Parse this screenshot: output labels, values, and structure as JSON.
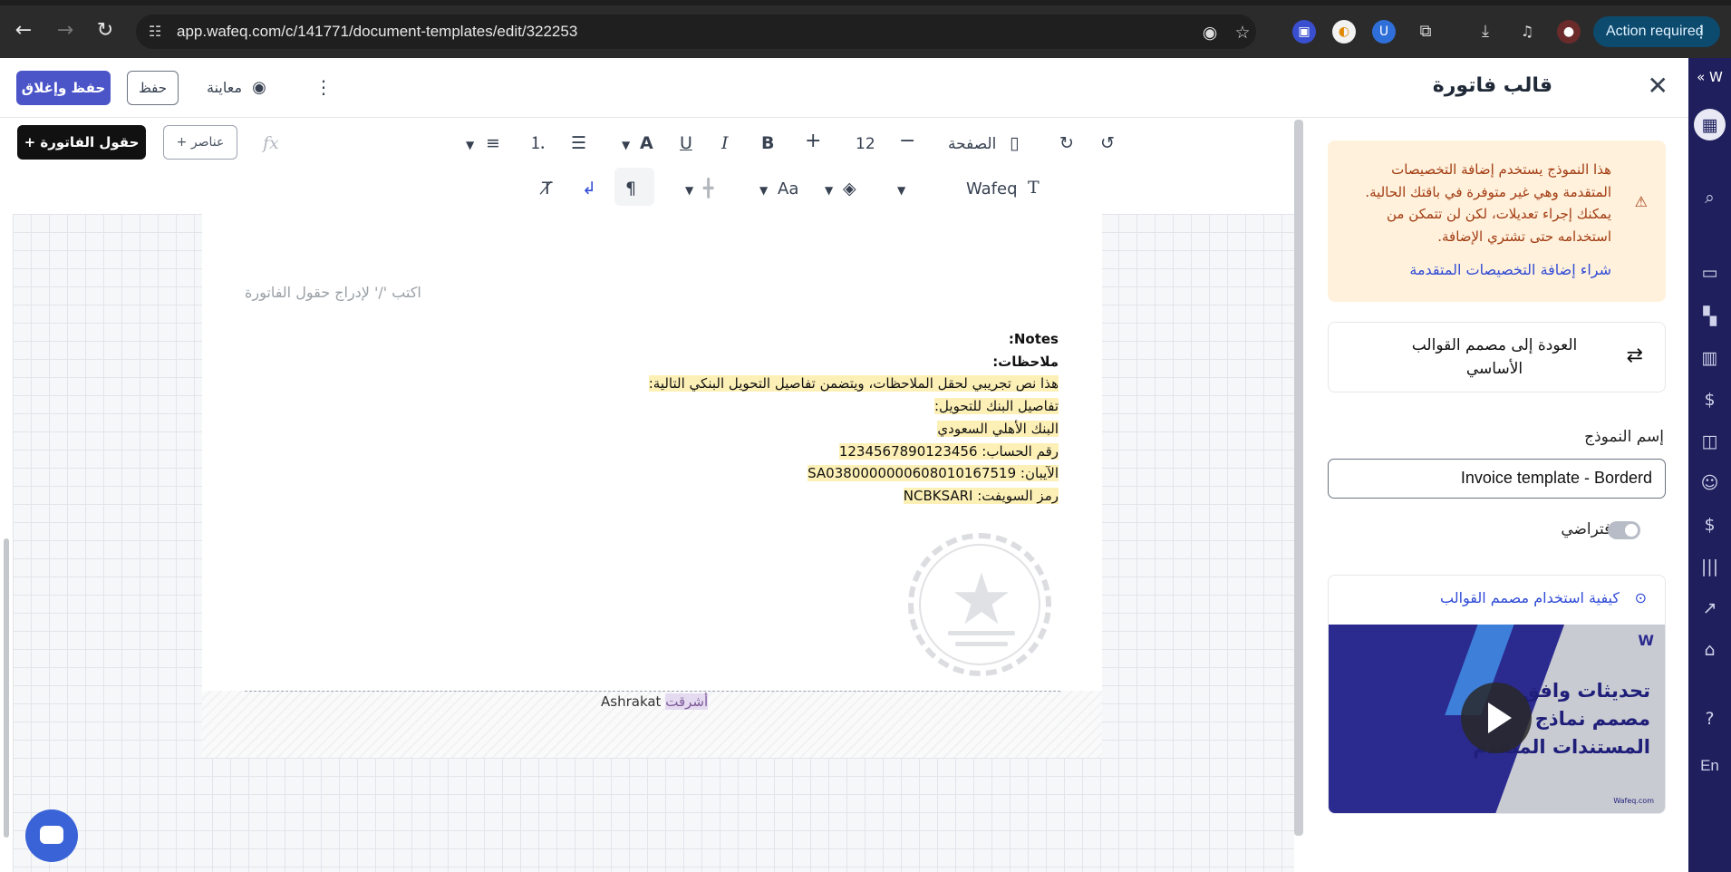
{
  "browser": {
    "url": "app.wafeq.com/c/141771/document-templates/edit/322253",
    "action_required": "Action required",
    "icons": [
      "back-arrow-icon",
      "forward-arrow-icon",
      "reload-icon",
      "site-settings-icon",
      "eye-icon",
      "star-icon",
      "extension-icon",
      "download-icon",
      "media-icon",
      "profile-icon",
      "kebab-icon"
    ]
  },
  "header": {
    "title": "قالب فاتورة",
    "save_close": "حفظ وإغلاق",
    "save": "حفظ",
    "preview": "معاينة"
  },
  "toolbar": {
    "invoice_fields": "+  حقول الفاتورة",
    "elements": "+ عناصر",
    "fx": "fx",
    "page": "الصفحة",
    "font_size": "12",
    "font_name": "Wafeq",
    "case": "Aa"
  },
  "document": {
    "placeholder": "اكتب '/' لإدراج حقول الفاتورة",
    "notes_en": "Notes:",
    "notes_ar": "ملاحظات:",
    "line1": "هذا نص تجريبي لحقل الملاحظات، ويتضمن تفاصيل التحويل البنكي التالية:",
    "line2": "تفاصيل البنك للتحويل:",
    "line3": "البنك الأهلي السعودي",
    "line4": "رقم الحساب: 1234567890123456",
    "line5": "الآيبان: SA0380000000608010167519",
    "line6": "رمز السويفت: NCBKSARI",
    "footer_name_en": "Ashrakat",
    "footer_name_ar": "أشرقت"
  },
  "panel": {
    "warning": "هذا النموذج يستخدم إضافة التخصيصات المتقدمة وهي غير متوفرة في باقتك الحالية. يمكنك إجراء تعديلات، لكن لن تتمكن من استخدامه حتى تشتري الإضافة.",
    "buy_link": "شراء إضافة التخصيصات المتقدمة",
    "back_to_basic": "العودة إلى مصمم القوالب الأساسي",
    "name_label": "إسم النموذج",
    "name_value": "Invoice template - Borderd",
    "default_label": "إفتراضي",
    "video_title": "كيفية استخدام مصمم القوالب",
    "video_headline": "تحديثات وافق مصمم نماذج المستندات المتقدم",
    "video_site": "Wafeq.com"
  },
  "sidebar": {
    "lang": "En",
    "icons": [
      "expand-icon",
      "building-icon",
      "search-icon",
      "inbox-icon",
      "dashboard-icon",
      "chart-icon",
      "dollar-icon",
      "bag-icon",
      "users-icon",
      "payroll-icon",
      "barcode-icon",
      "analytics-icon",
      "bank-icon",
      "help-icon"
    ]
  },
  "colors": {
    "primary": "#4b55c8",
    "sidebar": "#1e1f5c",
    "warning_bg": "#fff1dc",
    "warning_text": "#a23c12",
    "link": "#2f4bd6",
    "highlight": "#fdf0b6"
  }
}
